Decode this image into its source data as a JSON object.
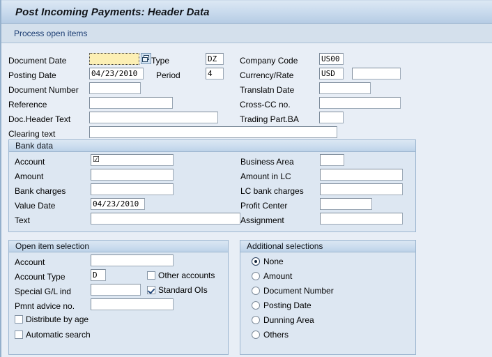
{
  "header": {
    "title": "Post Incoming Payments: Header Data",
    "toolbar_link": "Process open items"
  },
  "document_header": {
    "left": [
      {
        "label": "Document Date",
        "value": "",
        "focused": true,
        "matchcode": true
      },
      {
        "label": "Posting Date",
        "value": "04/23/2010"
      },
      {
        "label": "Document Number",
        "value": ""
      },
      {
        "label": "Reference",
        "value": ""
      },
      {
        "label": "Doc.Header Text",
        "value": ""
      },
      {
        "label": "Clearing text",
        "value": ""
      }
    ],
    "inline": [
      {
        "label": "Type",
        "value": "DZ"
      },
      {
        "label": "Period",
        "value": "4"
      }
    ],
    "right": [
      {
        "label": "Company Code",
        "value": "US00"
      },
      {
        "label": "Currency/Rate",
        "value": "USD",
        "rate": ""
      },
      {
        "label": "Translatn Date",
        "value": ""
      },
      {
        "label": "Cross-CC no.",
        "value": ""
      },
      {
        "label": "Trading Part.BA",
        "value": ""
      }
    ]
  },
  "bank_data": {
    "title": "Bank data",
    "left": [
      {
        "label": "Account",
        "value": "☑"
      },
      {
        "label": "Amount",
        "value": ""
      },
      {
        "label": "Bank charges",
        "value": ""
      },
      {
        "label": "Value Date",
        "value": "04/23/2010"
      },
      {
        "label": "Text",
        "value": ""
      }
    ],
    "right": [
      {
        "label": "Business Area",
        "value": ""
      },
      {
        "label": "Amount in LC",
        "value": ""
      },
      {
        "label": "LC bank charges",
        "value": ""
      },
      {
        "label": "Profit Center",
        "value": ""
      },
      {
        "label": "Assignment",
        "value": ""
      }
    ]
  },
  "open_item_selection": {
    "title": "Open item selection",
    "fields": [
      {
        "label": "Account",
        "value": ""
      },
      {
        "label": "Account Type",
        "value": "D"
      },
      {
        "label": "Special G/L ind",
        "value": ""
      },
      {
        "label": "Pmnt advice no.",
        "value": ""
      }
    ],
    "checkboxes": [
      {
        "label": "Other accounts",
        "checked": false
      },
      {
        "label": "Standard OIs",
        "checked": true
      },
      {
        "label": "Distribute by age",
        "checked": false
      },
      {
        "label": "Automatic search",
        "checked": false
      }
    ]
  },
  "additional_selections": {
    "title": "Additional selections",
    "options": [
      {
        "label": "None",
        "selected": true
      },
      {
        "label": "Amount",
        "selected": false
      },
      {
        "label": "Document Number",
        "selected": false
      },
      {
        "label": "Posting Date",
        "selected": false
      },
      {
        "label": "Dunning Area",
        "selected": false
      },
      {
        "label": "Others",
        "selected": false
      }
    ]
  },
  "colors": {
    "page_background": "#e8eef6",
    "title_bar": "#c3d6e9",
    "toolbar": "#d4e0ec",
    "group_background": "#dde7f2",
    "group_border": "#9cb6d0",
    "link_text": "#1a3c72",
    "focus_field": "#fcefb4"
  }
}
